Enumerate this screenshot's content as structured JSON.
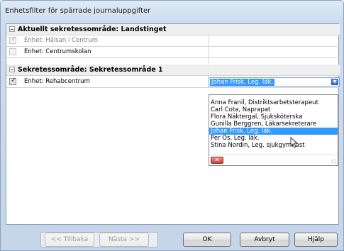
{
  "window": {
    "title": "Enhetsfilter för spärrade journaluppgifter"
  },
  "groups": [
    {
      "heading": "Aktuellt sekretessområde: Landstinget",
      "rows": [
        {
          "label": "Enhet: Hälsan i Centrum",
          "checked": true,
          "disabled": true
        },
        {
          "label": "Enhet: Centrumskolan",
          "checked": false,
          "disabled": true
        }
      ]
    },
    {
      "heading": "Sekretessområde: Sekretessområde 1",
      "rows": [
        {
          "label": "Enhet: Rehabcentrum",
          "checked": true,
          "disabled": false,
          "combo_value": "Johan Frisk, Leg. läk."
        }
      ]
    }
  ],
  "dropdown": {
    "options": [
      "Anna Franil, Distriktsarbetsterapeut",
      "Carl Cota, Naprapat",
      "Flora Näktergal, Sjuksköterska",
      "Gunilla Berggren, Läkarsekreterare",
      "Johan Frisk, Leg. läk.",
      "Per Os, Leg. läk.",
      "Stina Nordin, Leg. sjukgymnast"
    ],
    "selected_index": 4,
    "close_glyph": "✕"
  },
  "buttons": {
    "back": "<< Tillbaka",
    "next": "Nästa >>",
    "ok": "OK",
    "cancel": "Avbryt",
    "help": "Hjälp"
  }
}
